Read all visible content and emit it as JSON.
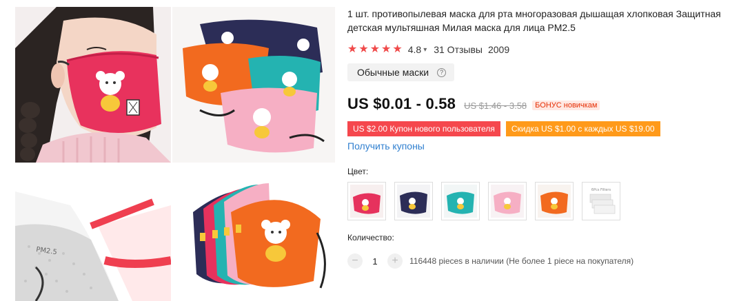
{
  "product": {
    "title": "1 шт. противопылевая маска для рта многоразовая дышащая хлопковая Защитная детская мультяшная Милая маска для лица PM2.5",
    "rating": "4.8",
    "reviews": "31 Отзывы",
    "orders": "2009",
    "category_tag": "Обычные маски",
    "price": "US $0.01 - 0.58",
    "old_price": "US $1.46 - 3.58",
    "bonus_badge": "БОНУС новичкам",
    "coupon_new_user": "US $2.00 Купон нового пользователя",
    "coupon_discount": "Скидка US $1.00 с каждых US $19.00",
    "get_coupons": "Получить купоны",
    "color_label": "Цвет:",
    "color_swatches": [
      "red",
      "navy",
      "teal",
      "pink",
      "orange",
      "filters"
    ],
    "swatch_filter_text": "6Pcs Filters",
    "quantity_label": "Количество:",
    "quantity_value": "1",
    "stock_text": "116448 pieces в наличии (Не более 1 piece на покупателя)",
    "mask_filter_print": "PM2.5"
  },
  "colors": {
    "price_red": "#f5474d",
    "coupon_orange": "#ff9a1a",
    "link_blue": "#2f7fcf",
    "star_red": "#f04a4a"
  }
}
